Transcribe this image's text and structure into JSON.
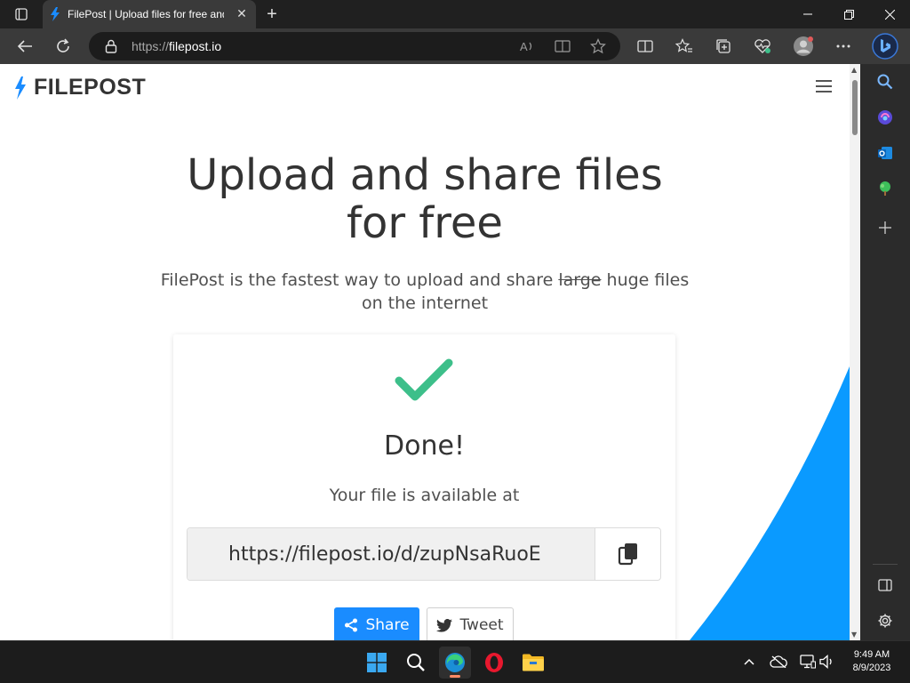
{
  "browser": {
    "tab_title": "FilePost | Upload files for free and share",
    "url_protocol": "https://",
    "url_host": "filepost.io"
  },
  "page": {
    "logo_text": "FILEPOST",
    "hero_title_line1": "Upload and share files",
    "hero_title_line2": "for free",
    "subtitle_before": "FilePost is the fastest way to upload and share ",
    "subtitle_strike": "large",
    "subtitle_after": " huge files on the internet",
    "done_heading": "Done!",
    "available_text": "Your file is available at",
    "file_url": "https://filepost.io/d/zupNsaRuoE",
    "share_label": "Share",
    "tweet_label": "Tweet"
  },
  "colors": {
    "accent": "#1a8cff",
    "check": "#3dbf8a",
    "wedge": "#0a9aff"
  },
  "taskbar": {
    "time": "9:49 AM",
    "date": "8/9/2023"
  }
}
